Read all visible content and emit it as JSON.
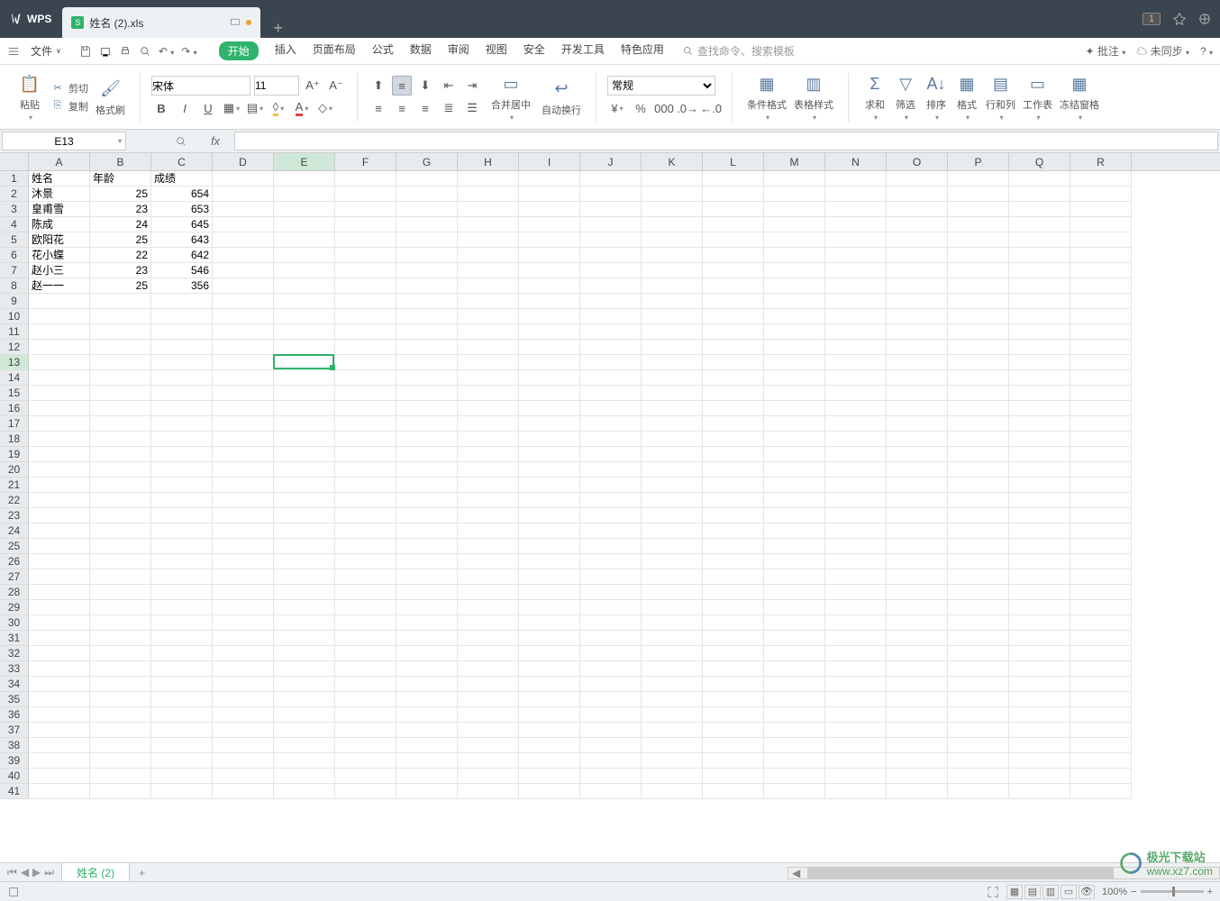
{
  "titlebar": {
    "logo_text": "WPS",
    "tab_name": "姓名 (2).xls",
    "badge": "1"
  },
  "menu": {
    "file": "文件",
    "tabs": [
      "开始",
      "插入",
      "页面布局",
      "公式",
      "数据",
      "审阅",
      "视图",
      "安全",
      "开发工具",
      "特色应用"
    ],
    "active_index": 0,
    "search_placeholder": "查找命令、搜索模板",
    "right": {
      "approve": "批注",
      "sync": "未同步"
    }
  },
  "ribbon": {
    "paste": "粘贴",
    "cut": "剪切",
    "copy": "复制",
    "fmt_painter": "格式刷",
    "font_name": "宋体",
    "font_size": "11",
    "merge": "合并居中",
    "wrap": "自动换行",
    "num_format": "常规",
    "cond_fmt": "条件格式",
    "tbl_style": "表格样式",
    "sum": "求和",
    "filter": "筛选",
    "sort": "排序",
    "format": "格式",
    "rowcol": "行和列",
    "sheet": "工作表",
    "freeze": "冻结窗格"
  },
  "fnbar": {
    "cell_ref": "E13",
    "formula": ""
  },
  "columns": [
    "A",
    "B",
    "C",
    "D",
    "E",
    "F",
    "G",
    "H",
    "I",
    "J",
    "K",
    "L",
    "M",
    "N",
    "O",
    "P",
    "Q",
    "R"
  ],
  "sel_col_index": 4,
  "sel_row_index": 12,
  "chart_data": {
    "type": "table",
    "headers": [
      "姓名",
      "年龄",
      "成绩"
    ],
    "rows": [
      [
        "沐景",
        25,
        654
      ],
      [
        "皇甫雪",
        23,
        653
      ],
      [
        "陈成",
        24,
        645
      ],
      [
        "欧阳花",
        25,
        643
      ],
      [
        "花小蝶",
        22,
        642
      ],
      [
        "赵小三",
        23,
        546
      ],
      [
        "赵一一",
        25,
        356
      ]
    ]
  },
  "sheet": {
    "active": "姓名 (2)"
  },
  "status": {
    "zoom": "100%"
  },
  "watermark": {
    "title": "极光下载站",
    "url": "www.xz7.com"
  }
}
